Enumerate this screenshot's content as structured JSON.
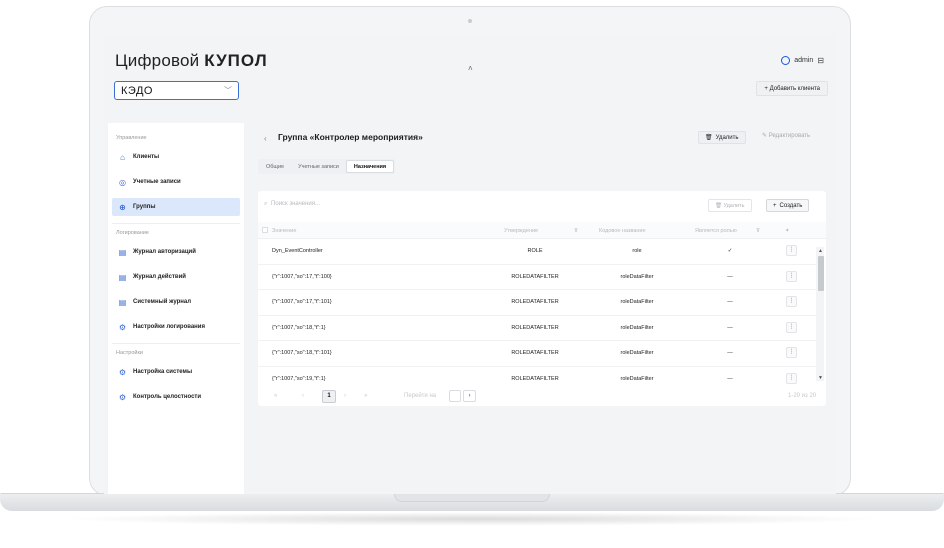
{
  "header": {
    "logo_regular": "Цифровой",
    "logo_bold": "КУПОЛ",
    "user": "admin",
    "org_select": "КЭДО",
    "add_client": "+ Добавить клиента"
  },
  "sidebar": {
    "sections": [
      {
        "title": "Управление",
        "items": [
          {
            "label": "Клиенты",
            "icon": "home-icon"
          },
          {
            "label": "Учетные записи",
            "icon": "user-icon"
          },
          {
            "label": "Группы",
            "icon": "group-icon",
            "active": true
          }
        ]
      },
      {
        "title": "Логирование",
        "items": [
          {
            "label": "Журнал авторизаций",
            "icon": "log-icon"
          },
          {
            "label": "Журнал действий",
            "icon": "log-icon"
          },
          {
            "label": "Системный журнал",
            "icon": "log-icon"
          },
          {
            "label": "Настройки логирования",
            "icon": "gear-icon"
          }
        ]
      },
      {
        "title": "Настройки",
        "items": [
          {
            "label": "Настройка системы",
            "icon": "gear-icon"
          },
          {
            "label": "Контроль целостности",
            "icon": "gear-icon"
          }
        ]
      }
    ]
  },
  "page": {
    "title": "Группа «Контролер мероприятия»",
    "delete_label": "Удалить",
    "edit_label": "Редактировать",
    "tabs": [
      "Общие",
      "Учетные записи",
      "Назначения"
    ],
    "active_tab": "Назначения"
  },
  "table": {
    "search_placeholder": "Поиск значения...",
    "delete_label": "Удалить",
    "create_label": "Создать",
    "columns": [
      "Значение",
      "Утверждение",
      "Кодовое название",
      "Является ролью"
    ],
    "rows": [
      {
        "value": "Dyn_EventController",
        "claim": "ROLE",
        "code": "role",
        "is_role": "✓"
      },
      {
        "value": "{\"r\":1007,\"so\":17,\"t\":100}",
        "claim": "ROLEDATAFILTER",
        "code": "roleDataFilter",
        "is_role": "—"
      },
      {
        "value": "{\"r\":1007,\"so\":17,\"t\":101}",
        "claim": "ROLEDATAFILTER",
        "code": "roleDataFilter",
        "is_role": "—"
      },
      {
        "value": "{\"r\":1007,\"so\":18,\"t\":1}",
        "claim": "ROLEDATAFILTER",
        "code": "roleDataFilter",
        "is_role": "—"
      },
      {
        "value": "{\"r\":1007,\"so\":18,\"t\":101}",
        "claim": "ROLEDATAFILTER",
        "code": "roleDataFilter",
        "is_role": "—"
      },
      {
        "value": "{\"r\":1007,\"so\":19,\"t\":1}",
        "claim": "ROLEDATAFILTER",
        "code": "roleDataFilter",
        "is_role": "—"
      }
    ]
  },
  "pagination": {
    "current_page": "1",
    "goto_label": "Перейти на",
    "range": "1-20 из 20"
  }
}
